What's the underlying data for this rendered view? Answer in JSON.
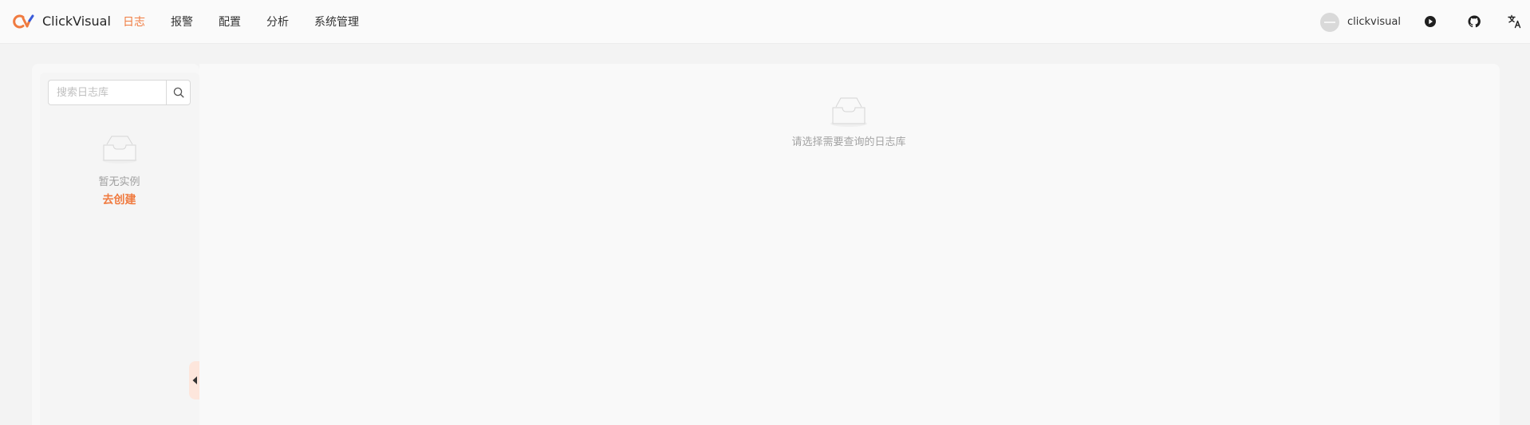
{
  "header": {
    "brand": "ClickVisual",
    "nav": [
      {
        "label": "日志",
        "active": true
      },
      {
        "label": "报警",
        "active": false
      },
      {
        "label": "配置",
        "active": false
      },
      {
        "label": "分析",
        "active": false
      },
      {
        "label": "系统管理",
        "active": false
      }
    ],
    "username": "clickvisual",
    "icons": [
      "avatar",
      "play-circle-icon",
      "github-icon",
      "translate-icon"
    ]
  },
  "sidebar": {
    "search": {
      "placeholder": "搜索日志库",
      "value": ""
    },
    "empty_text": "暂无实例",
    "create_link": "去创建"
  },
  "main": {
    "empty_text": "请选择需要查询的日志库"
  },
  "colors": {
    "accent": "#f07b40",
    "logo_orange": "#f07b40",
    "logo_blue": "#3a5bd9"
  }
}
